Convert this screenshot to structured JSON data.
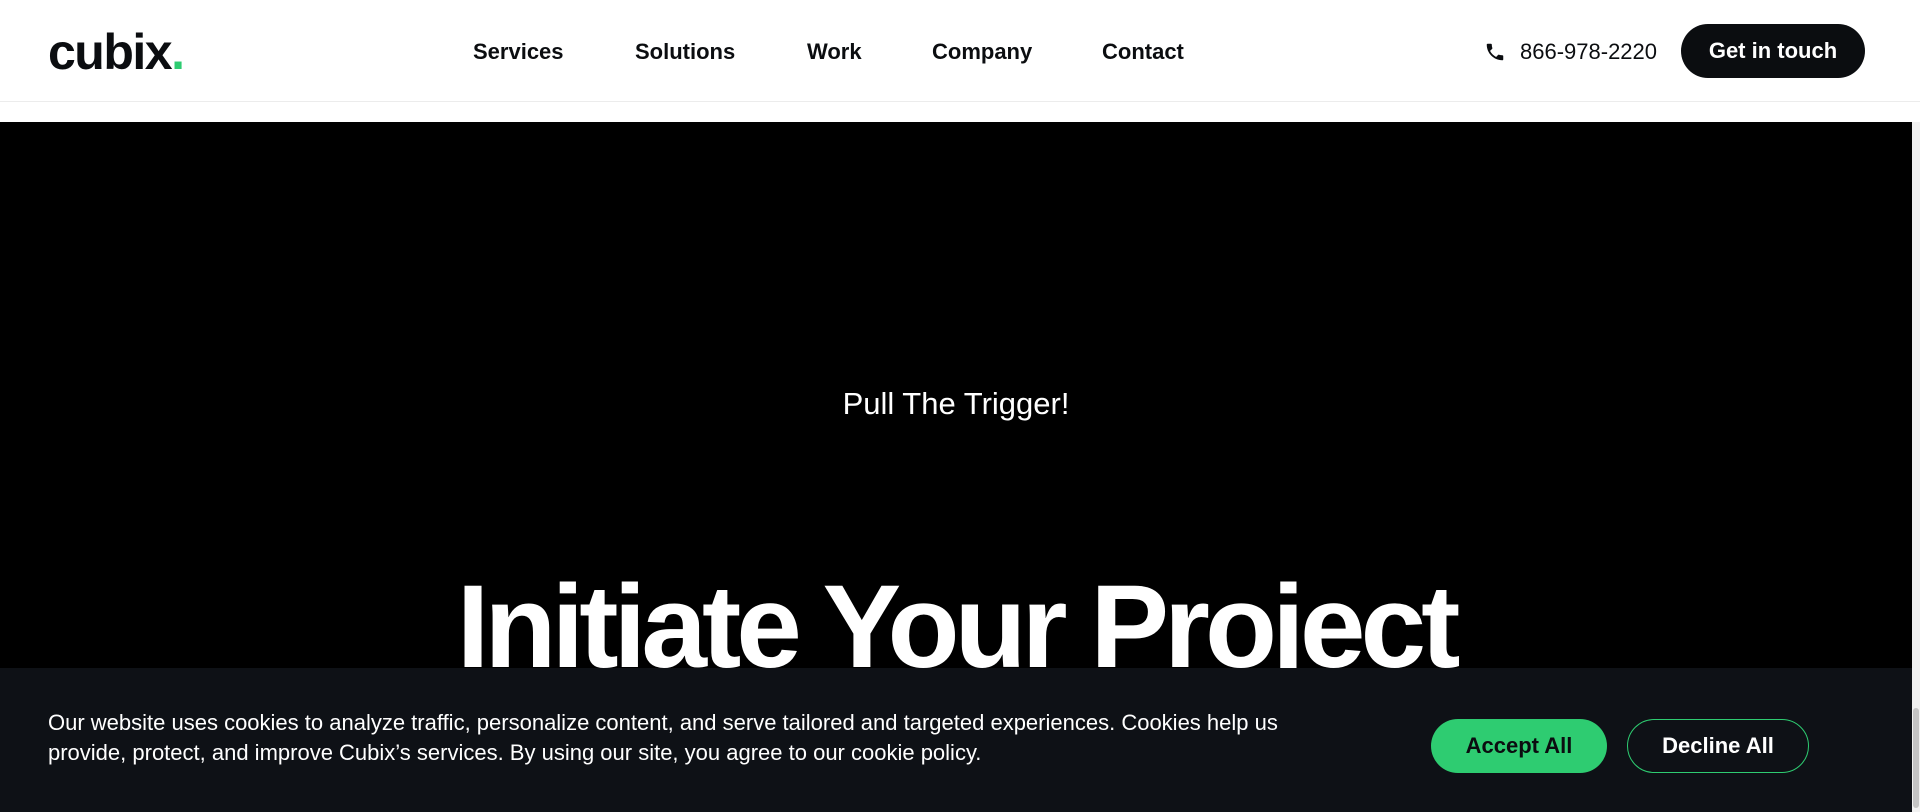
{
  "brand": {
    "logo_text": "cubix",
    "logo_dot": ".",
    "accent_color": "#2ecc71",
    "dark_color": "#0b0d10"
  },
  "nav": {
    "items": [
      {
        "label": "Services"
      },
      {
        "label": "Solutions"
      },
      {
        "label": "Work"
      },
      {
        "label": "Company"
      },
      {
        "label": "Contact"
      }
    ]
  },
  "header": {
    "phone_icon": "phone-icon",
    "phone_number": "866-978-2220",
    "cta_label": "Get in touch"
  },
  "hero": {
    "eyebrow": "Pull The Trigger!",
    "headline": "Initiate Your Project"
  },
  "cookie_banner": {
    "text": "Our website uses cookies to analyze traffic, personalize content, and serve tailored and targeted experiences. Cookies help us provide, protect, and improve Cubix’s services. By using our site, you agree to our cookie policy.",
    "accept_label": "Accept All",
    "decline_label": "Decline All"
  }
}
